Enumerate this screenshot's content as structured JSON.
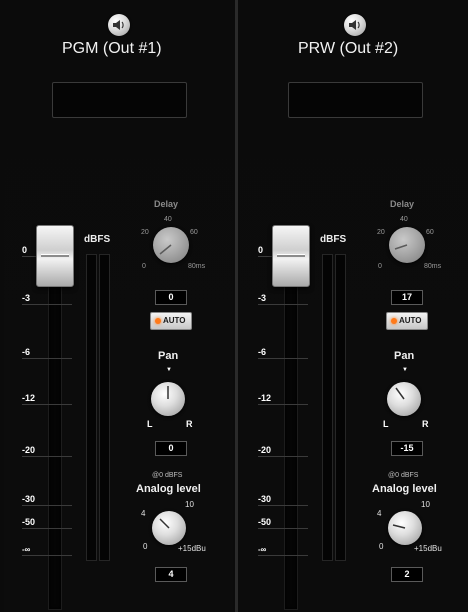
{
  "channels": [
    {
      "title": "PGM (Out #1)",
      "fader_scale": [
        "0",
        "-3",
        "-6",
        "-12",
        "-20",
        "-30",
        "-50",
        "-∞"
      ],
      "meter_label": "dBFS",
      "delay": {
        "title": "Delay",
        "ticks": [
          "20",
          "40",
          "60",
          "0",
          "80ms"
        ],
        "value": "0"
      },
      "auto_label": "AUTO",
      "pan": {
        "title": "Pan",
        "left": "L",
        "right": "R",
        "value": "0"
      },
      "analog": {
        "ref": "@0 dBFS",
        "title": "Analog level",
        "ticks": [
          "4",
          "10",
          "0",
          "+15dBu"
        ],
        "value": "4"
      }
    },
    {
      "title": "PRW (Out #2)",
      "fader_scale": [
        "0",
        "-3",
        "-6",
        "-12",
        "-20",
        "-30",
        "-50",
        "-∞"
      ],
      "meter_label": "dBFS",
      "delay": {
        "title": "Delay",
        "ticks": [
          "20",
          "40",
          "60",
          "0",
          "80ms"
        ],
        "value": "17"
      },
      "auto_label": "AUTO",
      "pan": {
        "title": "Pan",
        "left": "L",
        "right": "R",
        "value": "-15"
      },
      "analog": {
        "ref": "@0 dBFS",
        "title": "Analog level",
        "ticks": [
          "4",
          "10",
          "0",
          "+15dBu"
        ],
        "value": "2"
      }
    }
  ],
  "icons": {
    "mute": "speaker-icon",
    "auto_led": "led-icon"
  },
  "colors": {
    "background": "#0b0b0b",
    "auto_led": "#ff7a1a",
    "text": "#ffffff"
  }
}
